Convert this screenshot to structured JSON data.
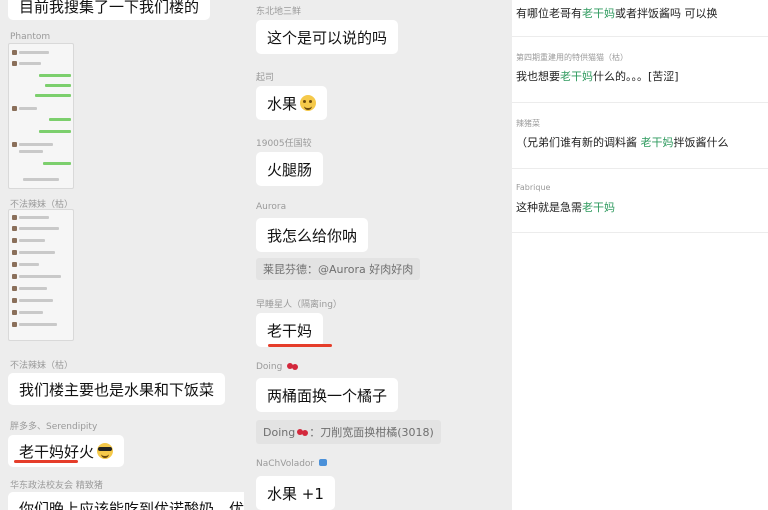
{
  "left_panel": {
    "bubble_top": "目前我搜集了一下我们楼的",
    "shot1_sender": "Phantom",
    "shot2_sender": "不法辣妹（枯）",
    "sender_1": "不法辣妹（枯）",
    "bubble_1": "我们楼主要也是水果和下饭菜",
    "sender_2": "胖多多、Serendipity",
    "bubble_2": "老干妈好火",
    "sender_3": "华东政法校友会 精致猪",
    "bubble_3": "你们晚上应该能吃到优诺酸奶，优"
  },
  "middle_panel": {
    "sender_1": "东北地三鲜",
    "bubble_1": "这个是可以说的吗",
    "sender_2": "起司",
    "bubble_2": "水果",
    "sender_3": "19005任国较",
    "bubble_3": "火腿肠",
    "sender_4": "Aurora",
    "bubble_4": "我怎么给你呐",
    "quote_4": "莱昆芬德：@Aurora 好肉好肉",
    "sender_5": "早睡星人（隔离ing）",
    "bubble_5": "老干妈",
    "sender_6": "Doing",
    "bubble_6": "两桶面换一个橘子",
    "quote_6_user": "Doing",
    "quote_6_text": "：刀削宽面换柑橘(3018)",
    "sender_7": "NaChVolador",
    "bubble_7": "水果 +1"
  },
  "right_panel": {
    "comments": [
      {
        "user": "",
        "text_before": "有哪位老哥有",
        "highlight": "老干妈",
        "text_after": "或者拌饭酱吗 可以换"
      },
      {
        "user": "第四期重建用的特供猫猫（枯）",
        "text_before": "我也想要",
        "highlight": "老干妈",
        "text_after": "什么的。。。[苦涩]"
      },
      {
        "user": "辣猪菜",
        "text_before": "（兄弟们谁有新的调料酱 ",
        "highlight": "老干妈",
        "text_after": "拌饭酱什么"
      },
      {
        "user": "Fabrique",
        "text_before": "这种就是急需",
        "highlight": "老干妈",
        "text_after": ""
      }
    ]
  },
  "colors": {
    "chat_background": "#ededed",
    "highlight_green": "#2e9a5e",
    "annotation_red": "#e53d2a"
  },
  "icons": {
    "smile": "grinning-face-emoji",
    "cool": "sunglasses-emoji",
    "cherry": "cherry-emoji",
    "wave": "water-emoji"
  }
}
